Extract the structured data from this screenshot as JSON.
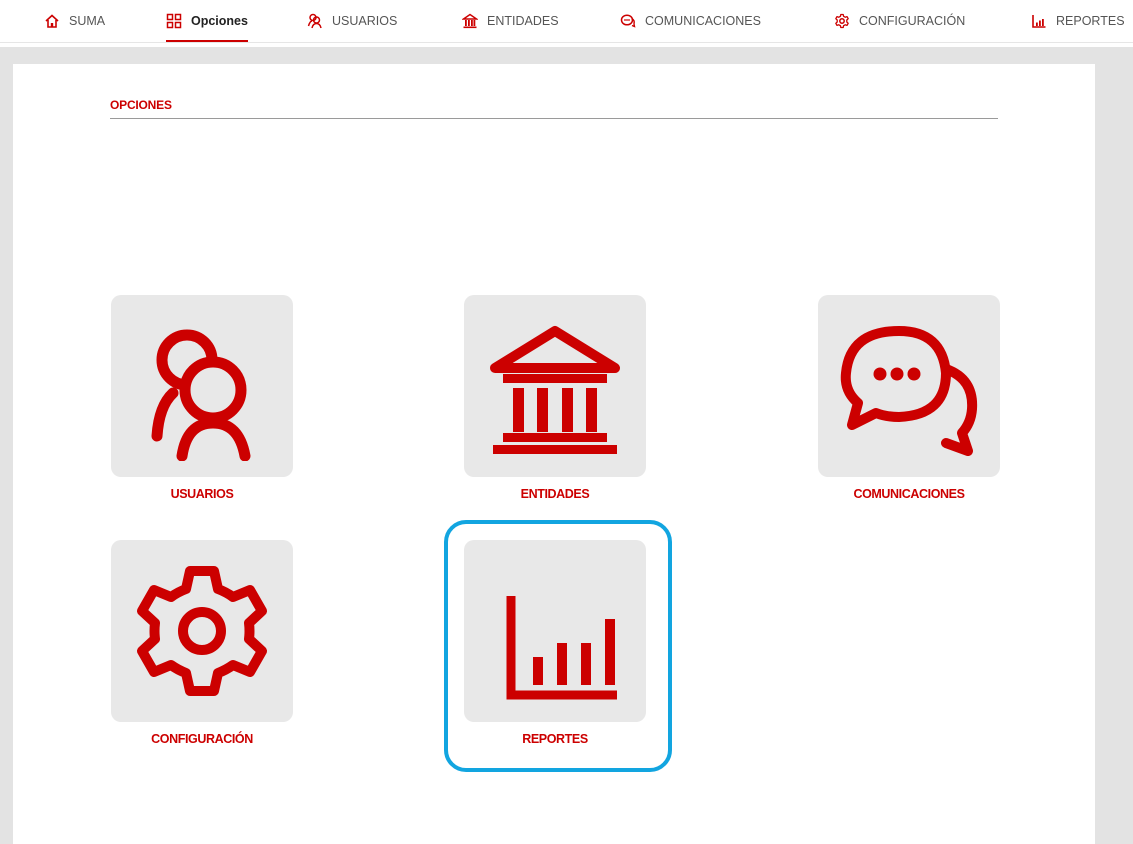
{
  "nav": {
    "items": [
      {
        "label": "SUMA",
        "icon": "home-icon",
        "active": false
      },
      {
        "label": "Opciones",
        "icon": "grid-icon",
        "active": true
      },
      {
        "label": "USUARIOS",
        "icon": "users-icon",
        "active": false
      },
      {
        "label": "ENTIDADES",
        "icon": "bank-icon",
        "active": false
      },
      {
        "label": "COMUNICACIONES",
        "icon": "chat-icon",
        "active": false
      },
      {
        "label": "CONFIGURACIÓN",
        "icon": "gear-icon",
        "active": false
      },
      {
        "label": "REPORTES",
        "icon": "chart-icon",
        "active": false
      }
    ]
  },
  "main": {
    "title": "OPCIONES",
    "tiles": [
      {
        "label": "USUARIOS",
        "icon": "users-icon"
      },
      {
        "label": "ENTIDADES",
        "icon": "bank-icon"
      },
      {
        "label": "COMUNICACIONES",
        "icon": "chat-icon"
      },
      {
        "label": "CONFIGURACIÓN",
        "icon": "gear-icon"
      },
      {
        "label": "REPORTES",
        "icon": "chart-icon",
        "highlighted": true
      }
    ]
  },
  "colors": {
    "accent": "#cc0000",
    "tile_bg": "#e8e8e8",
    "frame_bg": "#e3e3e3",
    "highlight": "#12a5e0"
  }
}
